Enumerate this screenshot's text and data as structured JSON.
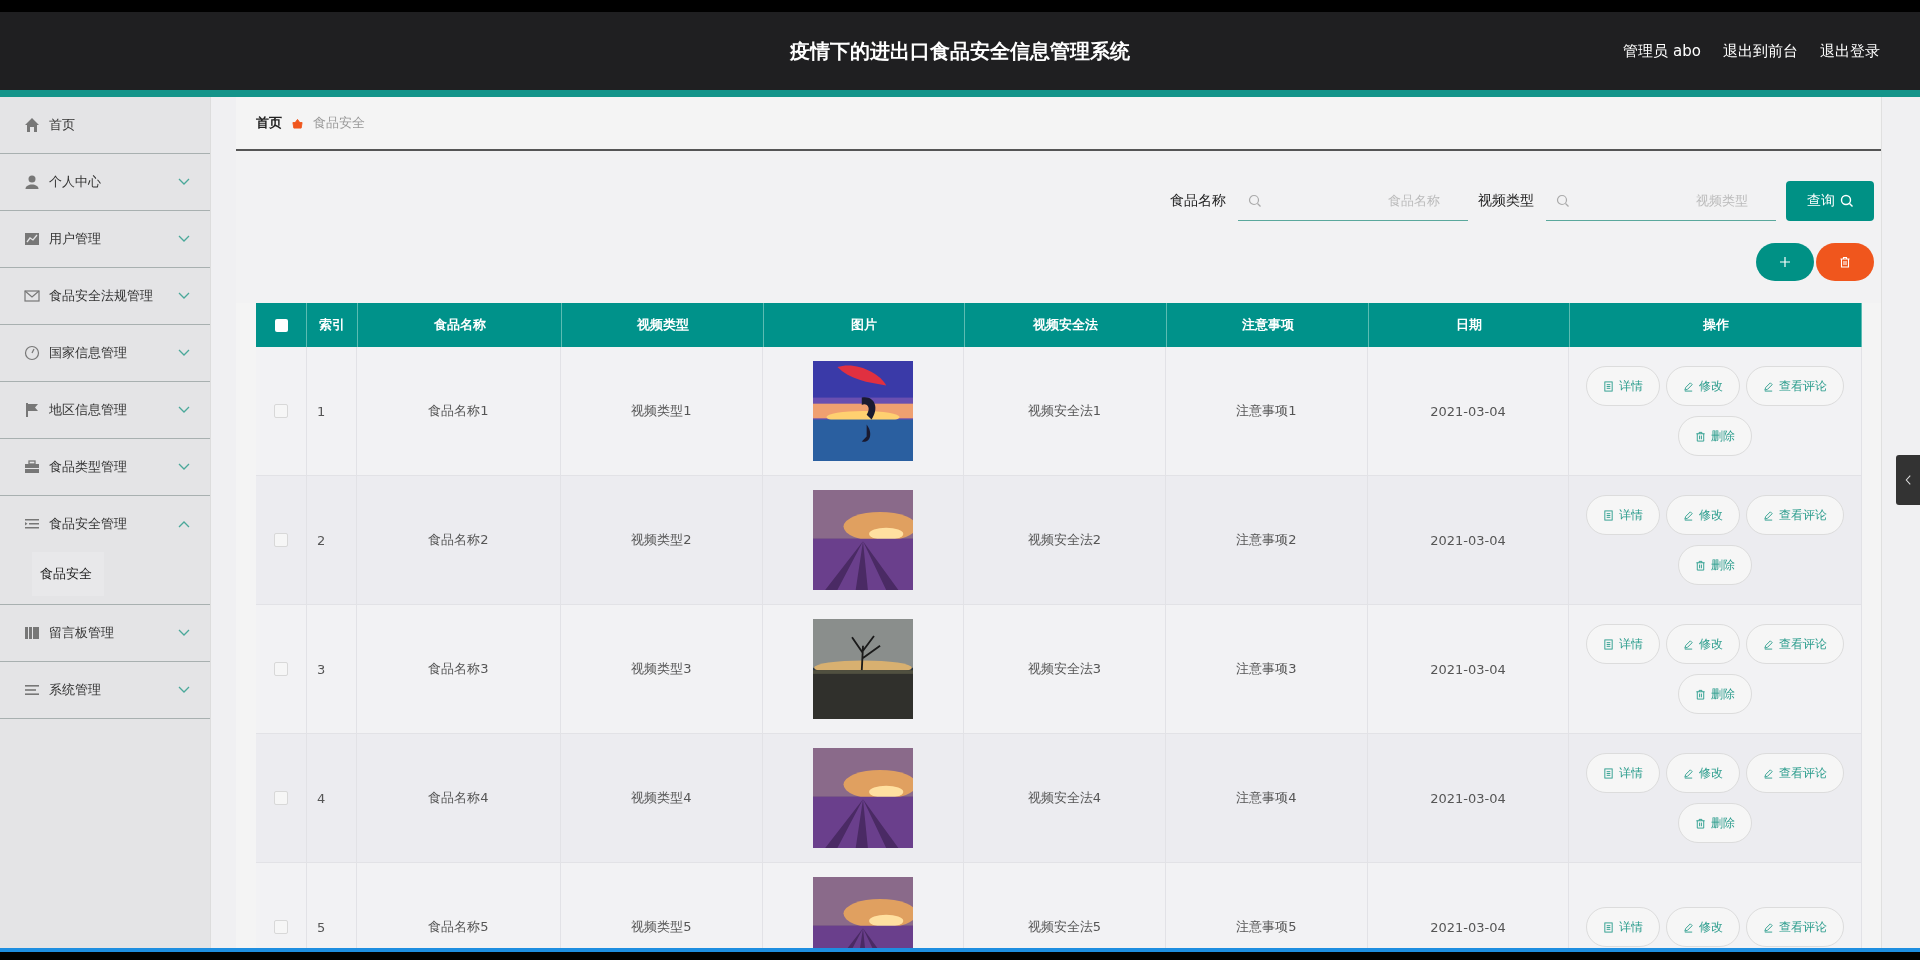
{
  "header": {
    "title": "疫情下的进出口食品安全信息管理系统",
    "links": [
      "管理员 abo",
      "退出到前台",
      "退出登录"
    ]
  },
  "sidebar": {
    "items": [
      {
        "label": "首页"
      },
      {
        "label": "个人中心",
        "expanded": false
      },
      {
        "label": "用户管理",
        "expanded": false
      },
      {
        "label": "食品安全法规管理",
        "expanded": false
      },
      {
        "label": "国家信息管理",
        "expanded": false
      },
      {
        "label": "地区信息管理",
        "expanded": false
      },
      {
        "label": "食品类型管理",
        "expanded": false
      },
      {
        "label": "食品安全管理",
        "expanded": true,
        "children": [
          {
            "label": "食品安全"
          }
        ]
      },
      {
        "label": "留言板管理",
        "expanded": false
      },
      {
        "label": "系统管理",
        "expanded": false
      }
    ]
  },
  "breadcrumb": [
    "首页",
    "食品安全"
  ],
  "search": {
    "fields": [
      {
        "label": "食品名称",
        "placeholder": "食品名称"
      },
      {
        "label": "视频类型",
        "placeholder": "视频类型"
      }
    ],
    "button": "查询"
  },
  "table": {
    "header_checked": false,
    "columns": [
      "索引",
      "食品名称",
      "视频类型",
      "图片",
      "视频安全法",
      "注意事项",
      "日期",
      "操作"
    ],
    "rows": [
      {
        "checked": false,
        "index": "1",
        "food_name": "食品名称1",
        "video_type": "视频类型1",
        "image": {
          "kind": "picture"
        },
        "safety_law": "视频安全法1",
        "notes": "注意事项1",
        "date": "2021-03-04",
        "actions": [
          "详情",
          "修改",
          "查看评论",
          "删除"
        ]
      },
      {
        "checked": false,
        "index": "2",
        "food_name": "食品名称2",
        "video_type": "视频类型2",
        "image": {
          "kind": "picture"
        },
        "safety_law": "视频安全法2",
        "notes": "注意事项2",
        "date": "2021-03-04",
        "actions": [
          "详情",
          "修改",
          "查看评论",
          "删除"
        ]
      },
      {
        "checked": false,
        "index": "3",
        "food_name": "食品名称3",
        "video_type": "视频类型3",
        "image": {
          "kind": "picture"
        },
        "safety_law": "视频安全法3",
        "notes": "注意事项3",
        "date": "2021-03-04",
        "actions": [
          "详情",
          "修改",
          "查看评论",
          "删除"
        ]
      },
      {
        "checked": false,
        "index": "4",
        "food_name": "食品名称4",
        "video_type": "视频类型4",
        "image": {
          "kind": "picture"
        },
        "safety_law": "视频安全法4",
        "notes": "注意事项4",
        "date": "2021-03-04",
        "actions": [
          "详情",
          "修改",
          "查看评论",
          "删除"
        ]
      },
      {
        "checked": false,
        "index": "5",
        "food_name": "食品名称5",
        "video_type": "视频类型5",
        "image": {
          "kind": "picture"
        },
        "safety_law": "视频安全法5",
        "notes": "注意事项5",
        "date": "2021-03-04",
        "actions": [
          "详情",
          "修改",
          "查看评论"
        ]
      }
    ]
  }
}
